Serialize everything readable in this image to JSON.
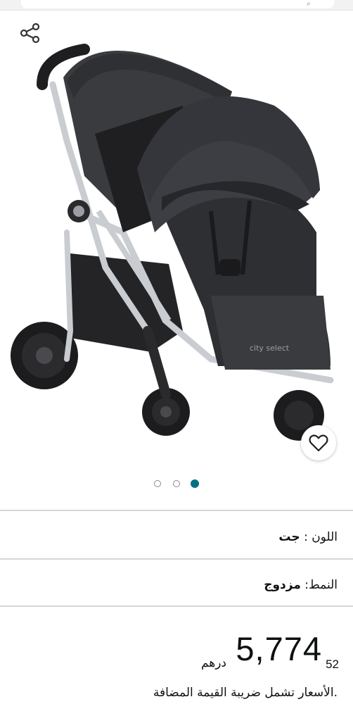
{
  "product": {
    "image_alt": "city select",
    "image_brand_text": "city select",
    "carousel": {
      "total": 3,
      "active_index": 3
    }
  },
  "attributes": [
    {
      "label": "اللون :",
      "value": "جت"
    },
    {
      "label": "النمط:",
      "value": "مزدوج"
    }
  ],
  "price": {
    "whole": "5,774",
    "fraction": "52",
    "currency": "درهم"
  },
  "vat_note": ".الأسعار تشمل ضريبة القيمة المضافة",
  "colors": {
    "accent": "#007185",
    "text": "#0f1111",
    "divider": "#d6d6d6",
    "fabric": "#2e2f33",
    "frame": "#c9ccd0"
  },
  "icons": {
    "share": "share-icon",
    "wishlist": "heart-icon"
  }
}
